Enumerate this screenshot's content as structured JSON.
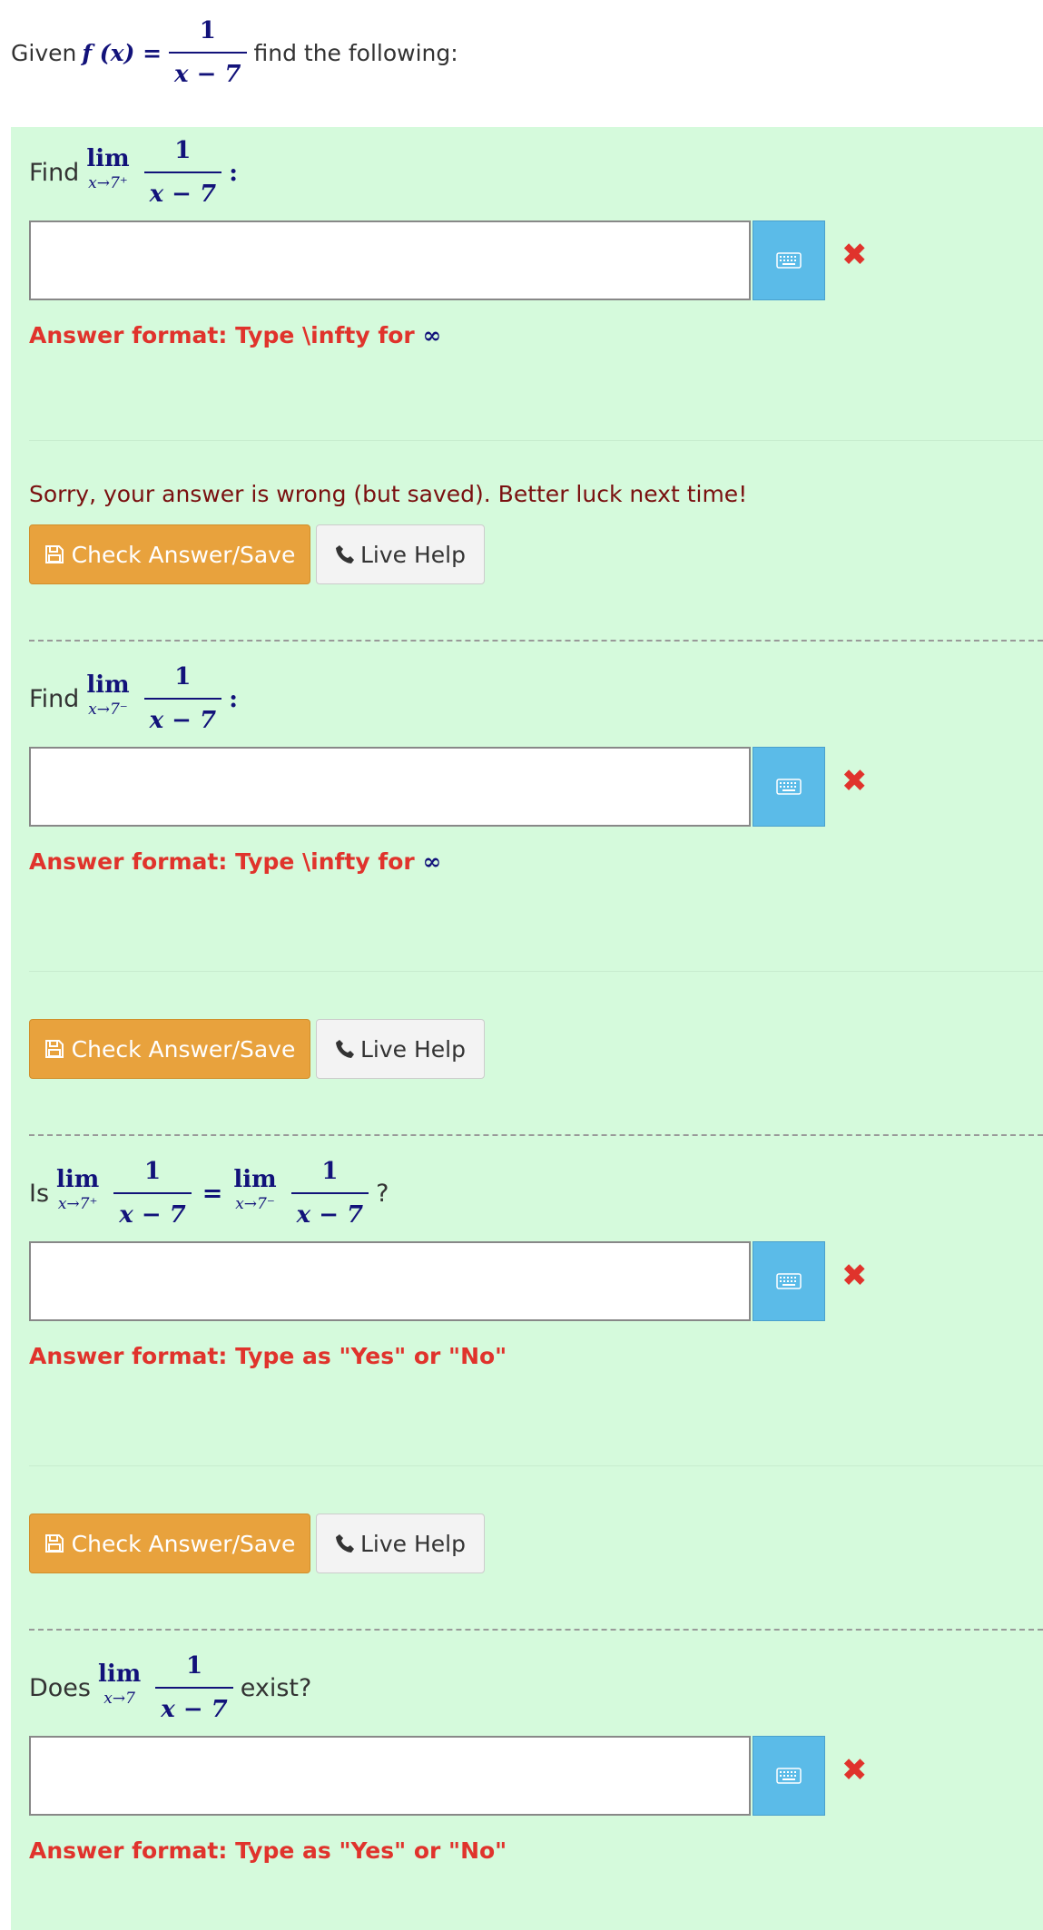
{
  "intro": {
    "given": "Given",
    "fx": "f (x) =",
    "num": "1",
    "den": "x − 7",
    "suffix": "find the following:"
  },
  "questions": [
    {
      "prefix": "Find",
      "lim_word": "lim",
      "lim_sub": "x→7⁺",
      "num": "1",
      "den": "x − 7",
      "suffix": ":",
      "answer_value": "",
      "format_text": "Answer format: Type \\infty for",
      "format_symbol": "∞",
      "feedback": "Sorry, your answer is wrong (but saved). Better luck next time!"
    },
    {
      "prefix": "Find",
      "lim_word": "lim",
      "lim_sub": "x→7⁻",
      "num": "1",
      "den": "x − 7",
      "suffix": ":",
      "answer_value": "",
      "format_text": "Answer format: Type \\infty for",
      "format_symbol": "∞"
    },
    {
      "prefix": "Is",
      "lim_word": "lim",
      "lim_sub": "x→7⁺",
      "num": "1",
      "den": "x − 7",
      "equals": "=",
      "lim2_word": "lim",
      "lim2_sub": "x→7⁻",
      "num2": "1",
      "den2": "x − 7",
      "suffix": "?",
      "answer_value": "",
      "format_text": "Answer format: Type as \"Yes\" or \"No\""
    },
    {
      "prefix": "Does",
      "lim_word": "lim",
      "lim_sub": "x→7",
      "num": "1",
      "den": "x − 7",
      "suffix": "exist?",
      "answer_value": "",
      "format_text": "Answer format: Type as \"Yes\" or \"No\""
    }
  ],
  "buttons": {
    "check": "Check Answer/Save",
    "help": "Live Help"
  },
  "icons": {
    "keyboard": "keyboard-icon",
    "wrong": "✖",
    "save": "floppy-icon",
    "phone": "phone-icon"
  },
  "colors": {
    "panel": "#d5fadc",
    "check": "#e8a23d",
    "keyboard": "#5bbbe8",
    "error": "#e0332c",
    "math": "#12127a"
  }
}
